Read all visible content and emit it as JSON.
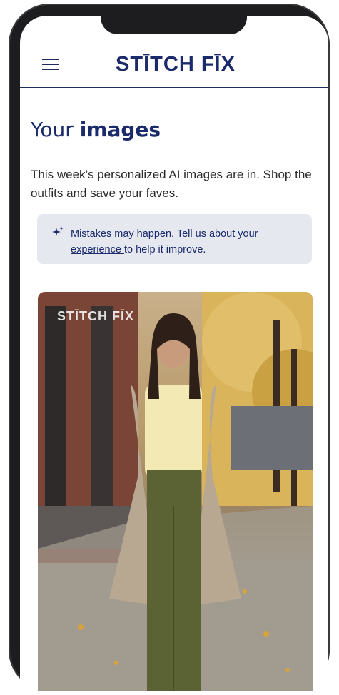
{
  "header": {
    "logo_text": "STĪTCH FĪX",
    "menu_icon": "hamburger-menu-icon"
  },
  "page": {
    "title_prefix": "Your ",
    "title_bold": "images",
    "description": "This week’s personalized AI images are in. Shop the outfits and save your faves."
  },
  "notice": {
    "icon": "sparkle-icon",
    "text_before": "Mistakes may happen. ",
    "link_text": "Tell us about your experience ",
    "text_after": "to help it improve."
  },
  "image": {
    "watermark": "STĪTCH FĪX"
  },
  "colors": {
    "brand_navy": "#1b2a6b",
    "notice_bg": "#e6e8ef"
  }
}
